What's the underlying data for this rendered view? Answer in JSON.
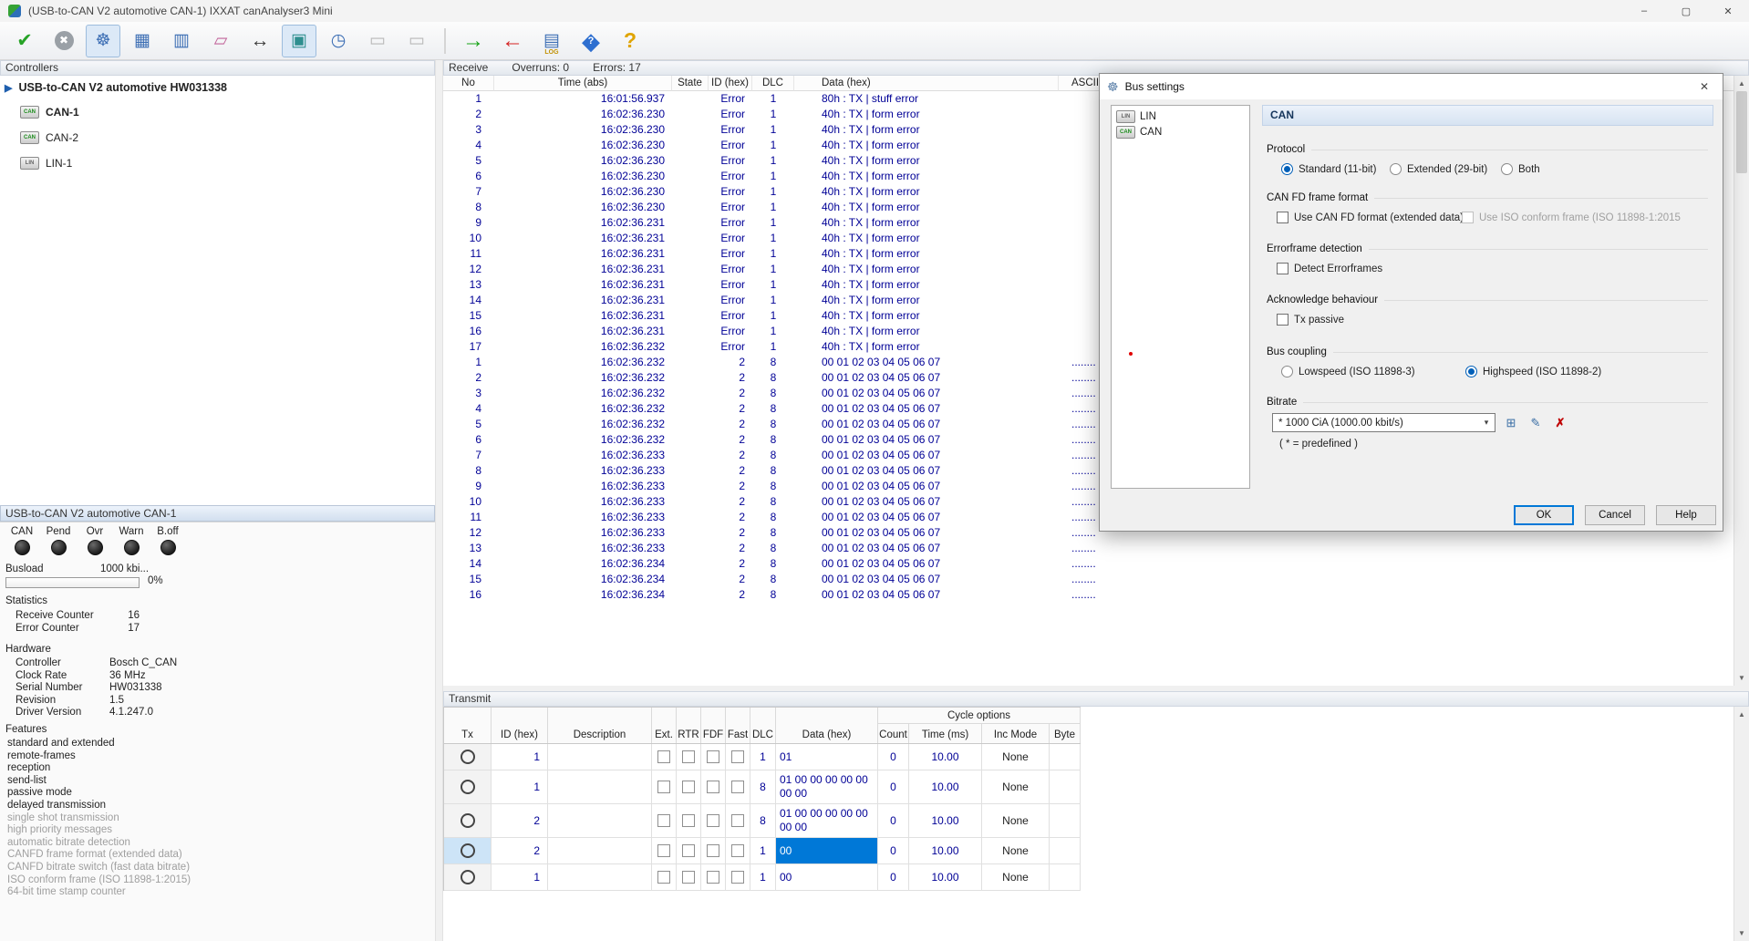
{
  "window": {
    "title": "(USB-to-CAN V2 automotive  CAN-1) IXXAT canAnalyser3 Mini",
    "controls": [
      {
        "name": "minimize-button",
        "glyph": "–"
      },
      {
        "name": "maximize-button",
        "glyph": "▢"
      },
      {
        "name": "close-button",
        "glyph": "✕"
      }
    ]
  },
  "colors": {
    "accent": "#0078d7",
    "table_text": "#000096",
    "selected_bg": "#0078d7",
    "selected_fg": "#ffffff"
  },
  "toolbar": {
    "left_buttons": [
      {
        "name": "connect-button",
        "glyph": "✔",
        "cls": "ic-green",
        "badge": ""
      },
      {
        "name": "disconnect-button",
        "glyph": "✖",
        "cls": "ic-graycircle",
        "badge": ""
      },
      {
        "name": "bus-settings-button",
        "glyph": "☸",
        "cls": "active ic-blue",
        "badge": ""
      },
      {
        "name": "message-view-button",
        "glyph": "▦",
        "cls": "ic-blue",
        "badge": ""
      },
      {
        "name": "layout-button",
        "glyph": "▥",
        "cls": "ic-blue",
        "badge": ""
      },
      {
        "name": "clear-button",
        "glyph": "▱",
        "cls": "ic-rose",
        "badge": ""
      },
      {
        "name": "bus-load-button",
        "glyph": "↔",
        "cls": "ic-dark",
        "badge": ""
      },
      {
        "name": "scope-view-button",
        "glyph": "▣",
        "cls": "active ic-teal",
        "badge": ""
      },
      {
        "name": "time-settings-button",
        "glyph": "◷",
        "cls": "ic-blue",
        "badge": ""
      },
      {
        "name": "monitor-button",
        "glyph": "▭",
        "cls": "ic-disabled",
        "badge": ""
      },
      {
        "name": "monitor-2-button",
        "glyph": "▭",
        "cls": "ic-disabled",
        "badge": ""
      }
    ],
    "right_buttons": [
      {
        "name": "start-receive-button",
        "glyph": "→",
        "cls": "ic-greenarrow",
        "badge": ""
      },
      {
        "name": "stop-receive-button",
        "glyph": "←",
        "cls": "ic-redarrow",
        "badge": ""
      },
      {
        "name": "log-button",
        "glyph": "▤",
        "cls": "ic-log",
        "badge": "LOG"
      },
      {
        "name": "info-button",
        "glyph": "◆",
        "cls": "ic-diamond",
        "badge": "?"
      },
      {
        "name": "help-button",
        "glyph": "?",
        "cls": "ic-help",
        "badge": ""
      }
    ]
  },
  "controllers": {
    "caption": "Controllers",
    "root_icon": "▶",
    "root": "USB-to-CAN V2 automotive  HW031338",
    "items": [
      {
        "label": "CAN-1",
        "icon": "CAN",
        "bold": true
      },
      {
        "label": "CAN-2",
        "icon": "CAN",
        "bold": false
      },
      {
        "label": "LIN-1",
        "icon": "LIN",
        "bold": false
      }
    ]
  },
  "receive": {
    "caption": "Receive",
    "overruns": "Overruns: 0",
    "errors": "Errors: 17",
    "columns": [
      "No",
      "Time (abs)",
      "State",
      "ID (hex)",
      "DLC",
      "Data (hex)",
      "ASCII"
    ],
    "rows": [
      {
        "no": "1",
        "time": "16:01:56.937",
        "state": "",
        "id": "Error",
        "dlc": "1",
        "data": "80h : TX | stuff error",
        "ascii": ""
      },
      {
        "no": "2",
        "time": "16:02:36.230",
        "state": "",
        "id": "Error",
        "dlc": "1",
        "data": "40h : TX | form error",
        "ascii": ""
      },
      {
        "no": "3",
        "time": "16:02:36.230",
        "state": "",
        "id": "Error",
        "dlc": "1",
        "data": "40h : TX | form error",
        "ascii": ""
      },
      {
        "no": "4",
        "time": "16:02:36.230",
        "state": "",
        "id": "Error",
        "dlc": "1",
        "data": "40h : TX | form error",
        "ascii": ""
      },
      {
        "no": "5",
        "time": "16:02:36.230",
        "state": "",
        "id": "Error",
        "dlc": "1",
        "data": "40h : TX | form error",
        "ascii": ""
      },
      {
        "no": "6",
        "time": "16:02:36.230",
        "state": "",
        "id": "Error",
        "dlc": "1",
        "data": "40h : TX | form error",
        "ascii": ""
      },
      {
        "no": "7",
        "time": "16:02:36.230",
        "state": "",
        "id": "Error",
        "dlc": "1",
        "data": "40h : TX | form error",
        "ascii": ""
      },
      {
        "no": "8",
        "time": "16:02:36.230",
        "state": "",
        "id": "Error",
        "dlc": "1",
        "data": "40h : TX | form error",
        "ascii": ""
      },
      {
        "no": "9",
        "time": "16:02:36.231",
        "state": "",
        "id": "Error",
        "dlc": "1",
        "data": "40h : TX | form error",
        "ascii": ""
      },
      {
        "no": "10",
        "time": "16:02:36.231",
        "state": "",
        "id": "Error",
        "dlc": "1",
        "data": "40h : TX | form error",
        "ascii": ""
      },
      {
        "no": "11",
        "time": "16:02:36.231",
        "state": "",
        "id": "Error",
        "dlc": "1",
        "data": "40h : TX | form error",
        "ascii": ""
      },
      {
        "no": "12",
        "time": "16:02:36.231",
        "state": "",
        "id": "Error",
        "dlc": "1",
        "data": "40h : TX | form error",
        "ascii": ""
      },
      {
        "no": "13",
        "time": "16:02:36.231",
        "state": "",
        "id": "Error",
        "dlc": "1",
        "data": "40h : TX | form error",
        "ascii": ""
      },
      {
        "no": "14",
        "time": "16:02:36.231",
        "state": "",
        "id": "Error",
        "dlc": "1",
        "data": "40h : TX | form error",
        "ascii": ""
      },
      {
        "no": "15",
        "time": "16:02:36.231",
        "state": "",
        "id": "Error",
        "dlc": "1",
        "data": "40h : TX | form error",
        "ascii": ""
      },
      {
        "no": "16",
        "time": "16:02:36.231",
        "state": "",
        "id": "Error",
        "dlc": "1",
        "data": "40h : TX | form error",
        "ascii": ""
      },
      {
        "no": "17",
        "time": "16:02:36.232",
        "state": "",
        "id": "Error",
        "dlc": "1",
        "data": "40h : TX | form error",
        "ascii": ""
      },
      {
        "no": "1",
        "time": "16:02:36.232",
        "state": "",
        "id": "2",
        "dlc": "8",
        "data": "00 01 02 03 04 05 06 07",
        "ascii": "........"
      },
      {
        "no": "2",
        "time": "16:02:36.232",
        "state": "",
        "id": "2",
        "dlc": "8",
        "data": "00 01 02 03 04 05 06 07",
        "ascii": "........"
      },
      {
        "no": "3",
        "time": "16:02:36.232",
        "state": "",
        "id": "2",
        "dlc": "8",
        "data": "00 01 02 03 04 05 06 07",
        "ascii": "........"
      },
      {
        "no": "4",
        "time": "16:02:36.232",
        "state": "",
        "id": "2",
        "dlc": "8",
        "data": "00 01 02 03 04 05 06 07",
        "ascii": "........"
      },
      {
        "no": "5",
        "time": "16:02:36.232",
        "state": "",
        "id": "2",
        "dlc": "8",
        "data": "00 01 02 03 04 05 06 07",
        "ascii": "........"
      },
      {
        "no": "6",
        "time": "16:02:36.232",
        "state": "",
        "id": "2",
        "dlc": "8",
        "data": "00 01 02 03 04 05 06 07",
        "ascii": "........"
      },
      {
        "no": "7",
        "time": "16:02:36.233",
        "state": "",
        "id": "2",
        "dlc": "8",
        "data": "00 01 02 03 04 05 06 07",
        "ascii": "........"
      },
      {
        "no": "8",
        "time": "16:02:36.233",
        "state": "",
        "id": "2",
        "dlc": "8",
        "data": "00 01 02 03 04 05 06 07",
        "ascii": "........"
      },
      {
        "no": "9",
        "time": "16:02:36.233",
        "state": "",
        "id": "2",
        "dlc": "8",
        "data": "00 01 02 03 04 05 06 07",
        "ascii": "........"
      },
      {
        "no": "10",
        "time": "16:02:36.233",
        "state": "",
        "id": "2",
        "dlc": "8",
        "data": "00 01 02 03 04 05 06 07",
        "ascii": "........"
      },
      {
        "no": "11",
        "time": "16:02:36.233",
        "state": "",
        "id": "2",
        "dlc": "8",
        "data": "00 01 02 03 04 05 06 07",
        "ascii": "........"
      },
      {
        "no": "12",
        "time": "16:02:36.233",
        "state": "",
        "id": "2",
        "dlc": "8",
        "data": "00 01 02 03 04 05 06 07",
        "ascii": "........"
      },
      {
        "no": "13",
        "time": "16:02:36.233",
        "state": "",
        "id": "2",
        "dlc": "8",
        "data": "00 01 02 03 04 05 06 07",
        "ascii": "........"
      },
      {
        "no": "14",
        "time": "16:02:36.234",
        "state": "",
        "id": "2",
        "dlc": "8",
        "data": "00 01 02 03 04 05 06 07",
        "ascii": "........"
      },
      {
        "no": "15",
        "time": "16:02:36.234",
        "state": "",
        "id": "2",
        "dlc": "8",
        "data": "00 01 02 03 04 05 06 07",
        "ascii": "........"
      },
      {
        "no": "16",
        "time": "16:02:36.234",
        "state": "",
        "id": "2",
        "dlc": "8",
        "data": "00 01 02 03 04 05 06 07",
        "ascii": "........"
      }
    ]
  },
  "status_panel": {
    "caption": "USB-to-CAN V2 automotive  CAN-1",
    "leds": [
      {
        "label": "CAN"
      },
      {
        "label": "Pend"
      },
      {
        "label": "Ovr"
      },
      {
        "label": "Warn"
      },
      {
        "label": "B.off"
      }
    ],
    "busload_label": "Busload",
    "busload_value": "1000 kbi...",
    "busload_percent": "0%",
    "statistics_label": "Statistics",
    "statistics": [
      [
        "Receive Counter",
        "16"
      ],
      [
        "Error Counter",
        "17"
      ]
    ],
    "hardware_label": "Hardware",
    "hardware": [
      [
        "Controller",
        "Bosch C_CAN"
      ],
      [
        "Clock Rate",
        "36 MHz"
      ],
      [
        "Serial Number",
        "HW031338"
      ],
      [
        "Revision",
        "1.5"
      ],
      [
        "Driver Version",
        "4.1.247.0"
      ]
    ],
    "features_label": "Features",
    "features": [
      {
        "label": "standard and extended",
        "dim": false
      },
      {
        "label": "remote-frames",
        "dim": false
      },
      {
        "label": "reception",
        "dim": false
      },
      {
        "label": "send-list",
        "dim": false
      },
      {
        "label": "passive mode",
        "dim": false
      },
      {
        "label": "delayed transmission",
        "dim": false
      },
      {
        "label": "single shot transmission",
        "dim": true
      },
      {
        "label": "high priority messages",
        "dim": true
      },
      {
        "label": "automatic bitrate detection",
        "dim": true
      },
      {
        "label": "CANFD frame format (extended data)",
        "dim": true
      },
      {
        "label": "CANFD bitrate switch (fast data bitrate)",
        "dim": true
      },
      {
        "label": "ISO conform frame (ISO 11898-1:2015)",
        "dim": true
      },
      {
        "label": "64-bit time stamp counter",
        "dim": true
      }
    ]
  },
  "transmit": {
    "caption": "Transmit",
    "group_header": "Cycle options",
    "columns": [
      "Tx",
      "ID (hex)",
      "Description",
      "Ext.",
      "RTR",
      "FDF",
      "Fast",
      "DLC",
      "Data (hex)",
      "Count",
      "Time (ms)",
      "Inc Mode",
      "Byte"
    ],
    "rows": [
      {
        "id": "1",
        "desc": "",
        "dlc": "1",
        "data": "01",
        "count": "0",
        "time": "10.00",
        "inc": "None",
        "byte": "",
        "selected": false
      },
      {
        "id": "1",
        "desc": "",
        "dlc": "8",
        "data": "01 00 00 00 00 00 00 00",
        "count": "0",
        "time": "10.00",
        "inc": "None",
        "byte": "",
        "selected": false
      },
      {
        "id": "2",
        "desc": "",
        "dlc": "8",
        "data": "01 00 00 00 00 00 00 00",
        "count": "0",
        "time": "10.00",
        "inc": "None",
        "byte": "",
        "selected": false
      },
      {
        "id": "2",
        "desc": "",
        "dlc": "1",
        "data": "00",
        "count": "0",
        "time": "10.00",
        "inc": "None",
        "byte": "",
        "selected": true
      },
      {
        "id": "1",
        "desc": "",
        "dlc": "1",
        "data": "00",
        "count": "0",
        "time": "10.00",
        "inc": "None",
        "byte": "",
        "selected": false
      }
    ]
  },
  "dialog": {
    "title": "Bus settings",
    "close_glyph": "✕",
    "icon_glyph": "☸",
    "tree": [
      {
        "label": "LIN",
        "icon": "LIN"
      },
      {
        "label": "CAN",
        "icon": "CAN"
      }
    ],
    "panel_title": "CAN",
    "protocol_label": "Protocol",
    "protocol_options": [
      "Standard (11-bit)",
      "Extended (29-bit)",
      "Both"
    ],
    "canfd_label": "CAN FD frame format",
    "canfd_cb": "Use CAN FD format (extended data)",
    "canfd_iso_cb": "Use ISO conform frame  (ISO 11898-1:2015",
    "errorframe_label": "Errorframe detection",
    "errorframe_cb": "Detect Errorframes",
    "ack_label": "Acknowledge behaviour",
    "ack_cb": "Tx passive",
    "coupling_label": "Bus coupling",
    "coupling_options": [
      "Lowspeed  (ISO 11898-3)",
      "Highspeed  (ISO 11898-2)"
    ],
    "bitrate_label": "Bitrate",
    "bitrate_value": "*  1000 CiA (1000.00 kbit/s)",
    "combo_arrow": "▾",
    "tool_buttons": [
      {
        "name": "bitrate-edit-button",
        "glyph": "⊞"
      },
      {
        "name": "bitrate-detect-button",
        "glyph": "✎"
      },
      {
        "name": "bitrate-delete-button",
        "glyph": "✗"
      }
    ],
    "bitrate_note": "( * = predefined )",
    "buttons": {
      "ok": "OK",
      "cancel": "Cancel",
      "help": "Help"
    }
  },
  "scrollbar": {
    "up": "▲",
    "down": "▼"
  }
}
